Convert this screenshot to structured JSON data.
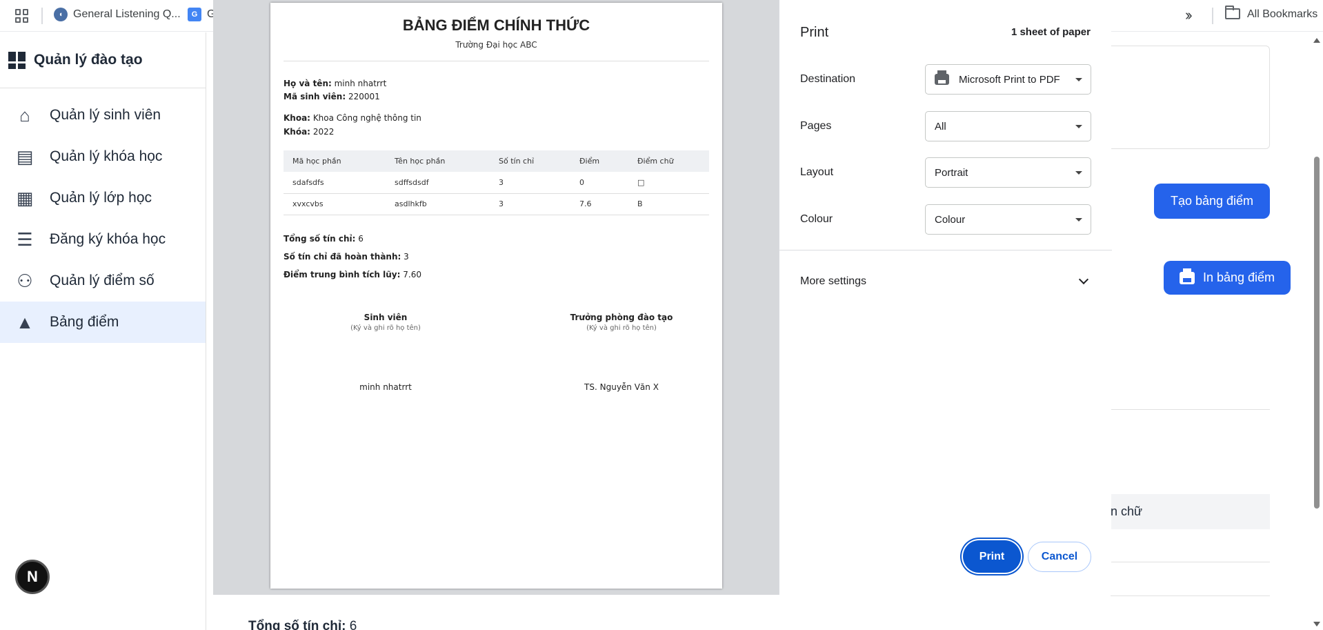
{
  "bookmarks": {
    "items": [
      {
        "label": "General Listening Q..."
      },
      {
        "label": "G"
      }
    ],
    "all_bookmarks": "All Bookmarks"
  },
  "sidebar": {
    "brand": "Quản lý đào tạo",
    "items": [
      {
        "label": "Quản lý sinh viên",
        "icon": "home-icon"
      },
      {
        "label": "Quản lý khóa học",
        "icon": "book-icon"
      },
      {
        "label": "Quản lý lớp học",
        "icon": "calendar-icon"
      },
      {
        "label": "Đăng ký khóa học",
        "icon": "checklist-icon"
      },
      {
        "label": "Quản lý điểm số",
        "icon": "people-icon"
      },
      {
        "label": "Bảng điểm",
        "icon": "school-icon",
        "active": true
      }
    ]
  },
  "background": {
    "create_button": "Tạo bảng điểm",
    "print_button": "In bảng điểm",
    "table_header_fragment": "n chữ",
    "total_label": "Tổng số tín chỉ:",
    "total_value": "6"
  },
  "preview": {
    "title": "BẢNG ĐIỂM CHÍNH THỨC",
    "school": "Trường Đại học ABC",
    "name_label": "Họ và tên:",
    "name_value": "minh nhatrrt",
    "id_label": "Mã sinh viên:",
    "id_value": "220001",
    "faculty_label": "Khoa:",
    "faculty_value": "Khoa Công nghệ thông tin",
    "cohort_label": "Khóa:",
    "cohort_value": "2022",
    "table": {
      "headers": [
        "Mã học phần",
        "Tên học phần",
        "Số tín chỉ",
        "Điểm",
        "Điểm chữ"
      ],
      "rows": [
        [
          "sdafsdfs",
          "sdffsdsdf",
          "3",
          "0",
          "□"
        ],
        [
          "xvxcvbs",
          "asdlhkfb",
          "3",
          "7.6",
          "B"
        ]
      ]
    },
    "total_credits_label": "Tổng số tín chỉ:",
    "total_credits_value": "6",
    "completed_label": "Số tín chỉ đã hoàn thành:",
    "completed_value": "3",
    "gpa_label": "Điểm trung bình tích lũy:",
    "gpa_value": "7.60",
    "sig_student_title": "Sinh viên",
    "sig_student_hint": "(Ký và ghi rõ họ tên)",
    "sig_head_title": "Trưởng phòng đào tạo",
    "sig_head_hint": "(Ký và ghi rõ họ tên)",
    "sig_student_name": "minh nhatrrt",
    "sig_head_name": "TS. Nguyễn Văn X"
  },
  "print_panel": {
    "title": "Print",
    "sheets": "1 sheet of paper",
    "destination_label": "Destination",
    "destination_value": "Microsoft Print to PDF",
    "pages_label": "Pages",
    "pages_value": "All",
    "layout_label": "Layout",
    "layout_value": "Portrait",
    "colour_label": "Colour",
    "colour_value": "Colour",
    "more_settings": "More settings",
    "print_button": "Print",
    "cancel_button": "Cancel"
  },
  "colors": {
    "accent": "#2563eb",
    "print_primary": "#0b57d0",
    "active_nav_bg": "#e8f0fe"
  }
}
